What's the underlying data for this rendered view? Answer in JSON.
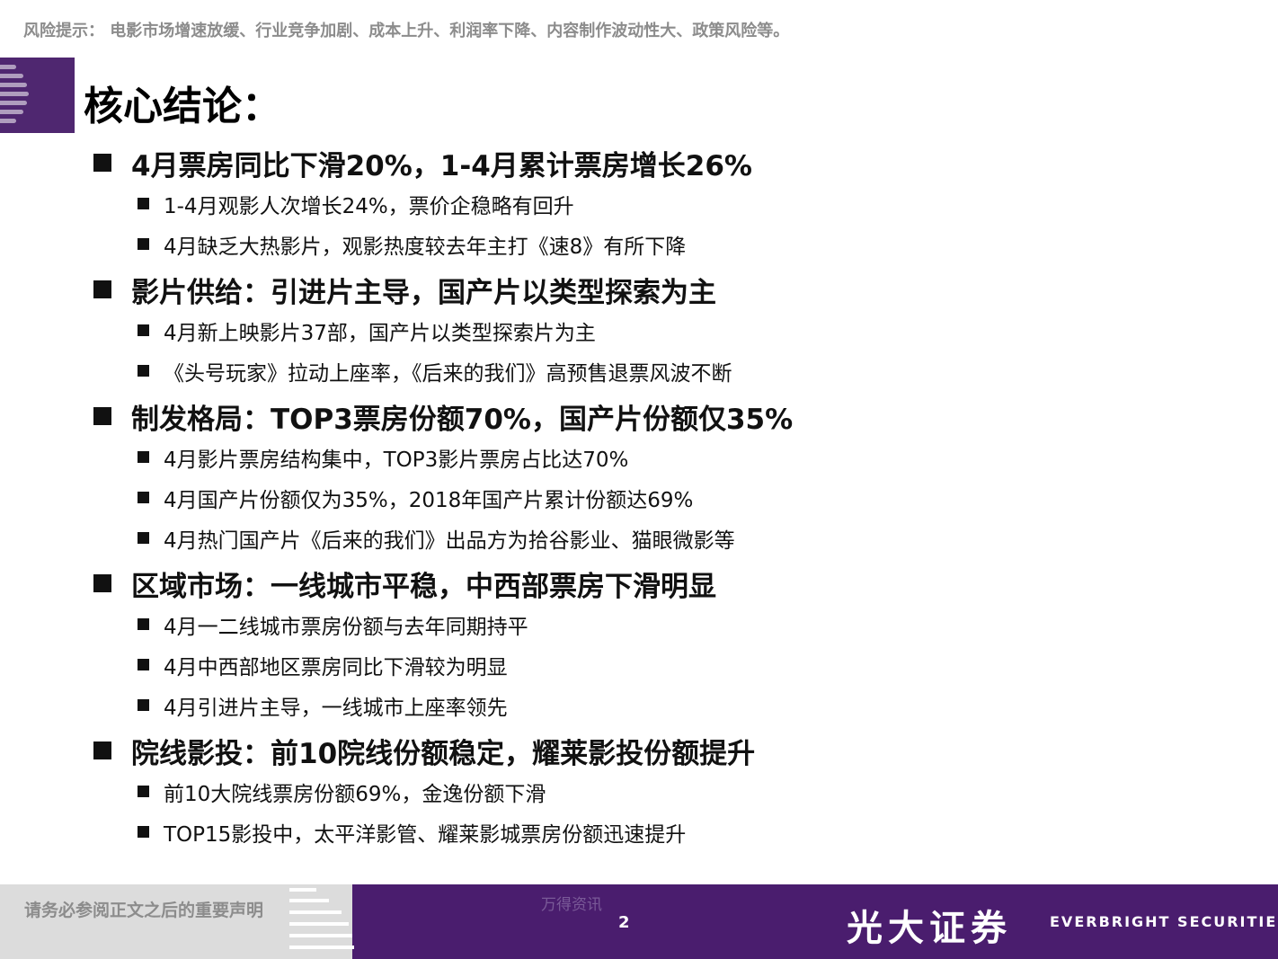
{
  "risk_notice": "风险提示： 电影市场增速放缓、行业竞争加剧、成本上升、利润率下降、内容制作波动性大、政策风险等。",
  "title": "核心结论：",
  "sections": [
    {
      "heading": "4月票房同比下滑20%，1-4月累计票房增长26%",
      "items": [
        "1-4月观影人次增长24%，票价企稳略有回升",
        "4月缺乏大热影片，观影热度较去年主打《速8》有所下降"
      ]
    },
    {
      "heading": "影片供给：引进片主导，国产片以类型探索为主",
      "items": [
        "4月新上映影片37部，国产片以类型探索片为主",
        "《头号玩家》拉动上座率，《后来的我们》高预售退票风波不断"
      ]
    },
    {
      "heading": "制发格局：TOP3票房份额70%，国产片份额仅35%",
      "items": [
        "4月影片票房结构集中，TOP3影片票房占比达70%",
        "4月国产片份额仅为35%，2018年国产片累计份额达69%",
        "4月热门国产片《后来的我们》出品方为拾谷影业、猫眼微影等"
      ]
    },
    {
      "heading": "区域市场：一线城市平稳，中西部票房下滑明显",
      "items": [
        "4月一二线城市票房份额与去年同期持平",
        "4月中西部地区票房同比下滑较为明显",
        "4月引进片主导，一线城市上座率领先"
      ]
    },
    {
      "heading": "院线影投：前10院线份额稳定，耀莱影投份额提升",
      "items": [
        "前10大院线票房份额69%，金逸份额下滑",
        "TOP15影投中，太平洋影管、耀莱影城票房份额迅速提升"
      ]
    }
  ],
  "footer": {
    "disclaimer": "请务必参阅正文之后的重要声明",
    "watermark": "万得资讯",
    "page_number": "2",
    "brand_cn": "光大证券",
    "brand_en": "EVERBRIGHT SECURITIES"
  }
}
